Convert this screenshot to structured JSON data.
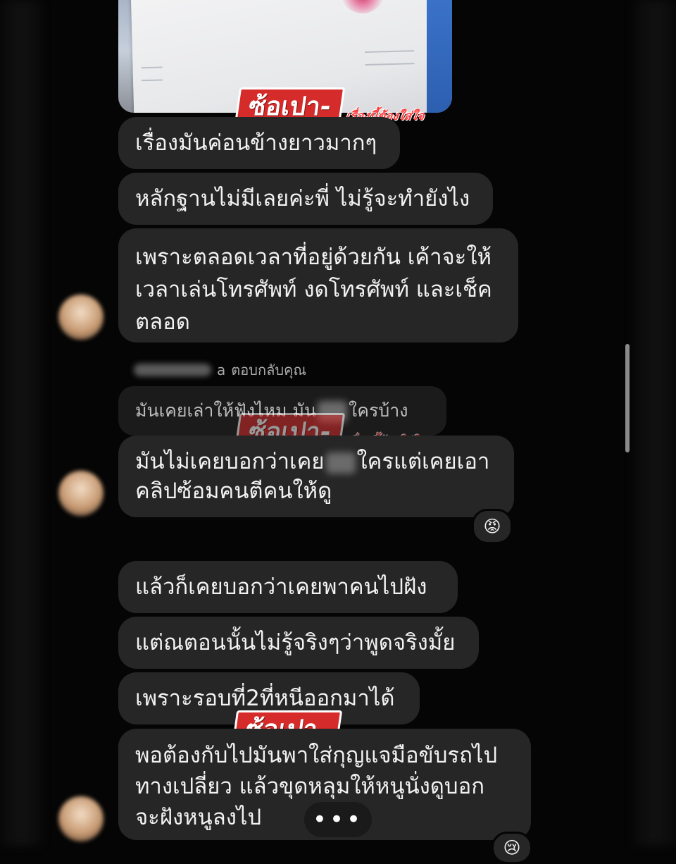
{
  "messages": [
    {
      "text": "เรื่องมันค่อนข้างยาวมากๆ"
    },
    {
      "text": "หลักฐานไม่มีเลยค่ะพี่ ไม่รู้จะทำยังไง"
    },
    {
      "line1": "เพราะตลอดเวลาที่อยู่ด้วยกัน เค้าจะให้",
      "line2": "เวลาเล่นโทรศัพท์ งดโทรศัพท์ และเช็ค",
      "line3": "ตลอด"
    },
    {
      "line1_a": "มันไม่เคยบอกว่าเคย",
      "line1_b": "ใครแต่เคยเอา",
      "line2": "คลิปซ้อมคนตีคนให้ดู"
    },
    {
      "text": "แล้วก็เคยบอกว่าเคยพาคนไปฝัง"
    },
    {
      "text": "แต่ณตอนนั้นไม่รู้จริงๆว่าพูดจริงมั้ย"
    },
    {
      "text": "เพราะรอบที่2ที่หนีออกมาได้"
    },
    {
      "line1": "พอต้องกับไปมันพาใส่กุญแจมือขับรถไป",
      "line2": "ทางเปลี่ยว แล้วขุดหลุมให้หนูนั่งดูบอก",
      "line3": "จะฝังหนูลงไป"
    }
  ],
  "reply": {
    "name_suffix": "a",
    "label": "ตอบกลับคุณ",
    "quoted_a": "มันเคยเล่าให้ฟังไหม มัน",
    "quoted_b": "ใครบ้าง"
  },
  "reactions": {
    "angry": "😡",
    "partial": "😢"
  },
  "typing_indicator": "•••",
  "watermark": {
    "main": "ซ้อเปา-",
    "sub": "เรื่องนี้ต้องใส่ใจ"
  }
}
